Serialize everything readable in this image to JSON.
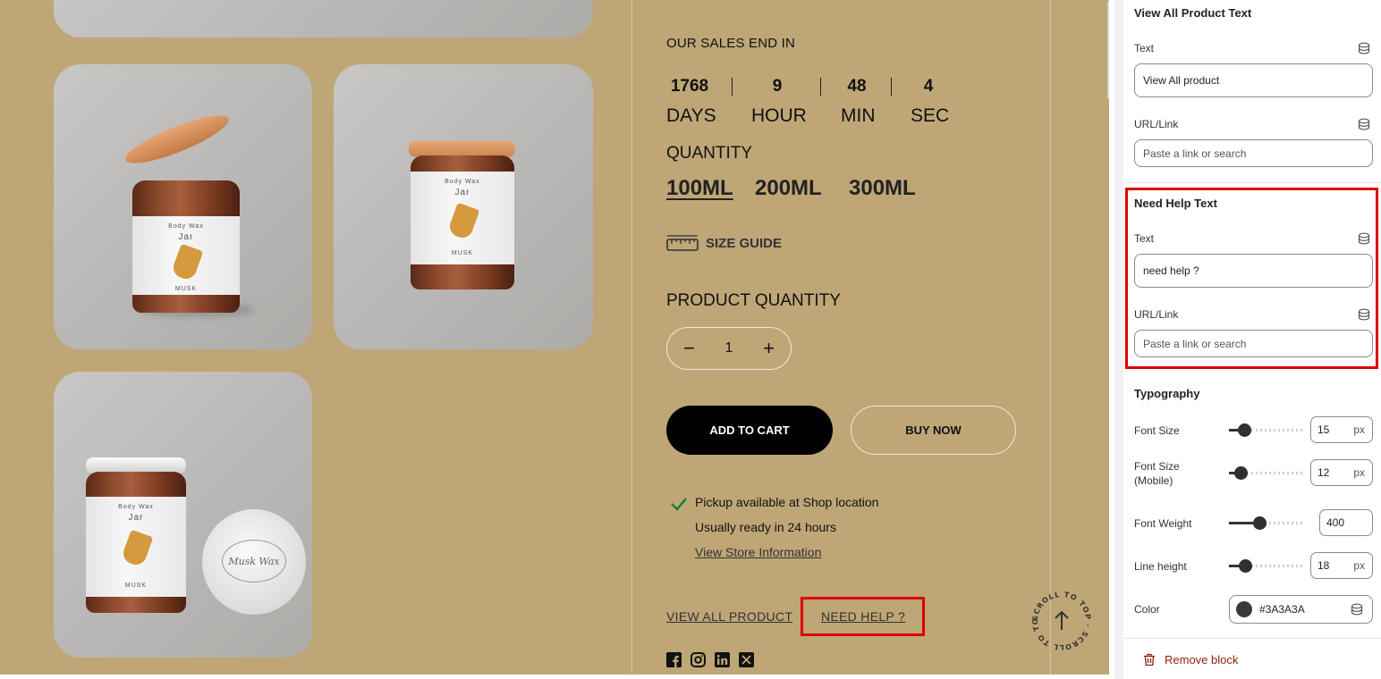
{
  "preview": {
    "sales_end_title": "OUR SALES END IN",
    "countdown": [
      {
        "value": "1768",
        "unit": "DAYS"
      },
      {
        "value": "9",
        "unit": "HOUR"
      },
      {
        "value": "48",
        "unit": "MIN"
      },
      {
        "value": "4",
        "unit": "SEC"
      }
    ],
    "quantity_title": "QUANTITY",
    "sizes": [
      "100ML",
      "200ML",
      "300ML"
    ],
    "selected_size": "100ML",
    "size_guide_label": "SIZE GUIDE",
    "product_quantity_title": "PRODUCT QUANTITY",
    "stepper": {
      "minus": "−",
      "value": "1",
      "plus": "+"
    },
    "add_to_cart": "ADD TO CART",
    "buy_now": "BUY NOW",
    "pickup": {
      "line1": "Pickup available at Shop location",
      "line2": "Usually ready in 24 hours",
      "link": "View Store Information"
    },
    "view_all_link": "VIEW ALL PRODUCT",
    "need_help_link": "NEED HELP ?",
    "socials": [
      "facebook-icon",
      "instagram-icon",
      "linkedin-icon",
      "x-icon"
    ],
    "scroll_top_text": "SCROLL TO TOP · SCROLL TO TOP ·",
    "jar_label": {
      "line1": "Body Wax",
      "line2": "Jar",
      "line3": "MUSK"
    },
    "lid_text": "Musk Wax",
    "background_color": "#bea676"
  },
  "panel": {
    "view_all_section": {
      "title": "View All Product Text",
      "text_label": "Text",
      "text_value": "View All product",
      "url_label": "URL/Link",
      "url_placeholder": "Paste a link or search"
    },
    "need_help_section": {
      "title": "Need Help Text",
      "text_label": "Text",
      "text_value": "need help ?",
      "url_label": "URL/Link",
      "url_placeholder": "Paste a link or search"
    },
    "typography": {
      "title": "Typography",
      "font_size": {
        "label": "Font Size",
        "value": "15",
        "unit": "px",
        "level": 0.2
      },
      "font_size_mobile": {
        "label": "Font Size\n(Mobile)",
        "value": "12",
        "unit": "px",
        "level": 0.15
      },
      "font_weight": {
        "label": "Font Weight",
        "value": "400",
        "level": 0.4
      },
      "line_height": {
        "label": "Line height",
        "value": "18",
        "unit": "px",
        "level": 0.22
      },
      "color": {
        "label": "Color",
        "value": "#3A3A3A"
      }
    },
    "remove_block": "Remove block",
    "accent_red": "#e00000",
    "remove_color": "#8e1f0b"
  }
}
